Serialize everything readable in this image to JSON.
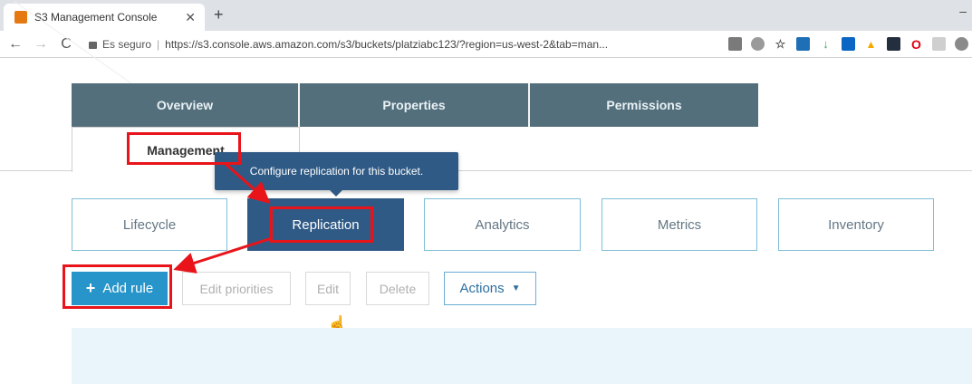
{
  "browser": {
    "tab_title": "S3 Management Console",
    "tab_close": "✕",
    "new_tab": "+",
    "window_minimize": "–",
    "nav": {
      "back": "←",
      "forward": "→",
      "reload": "C"
    },
    "secure_label": "Es seguro",
    "url": "https://s3.console.aws.amazon.com/s3/buckets/platziabc123/?region=us-west-2&tab=man..."
  },
  "top_tabs": [
    {
      "label": "Overview"
    },
    {
      "label": "Properties"
    },
    {
      "label": "Permissions"
    }
  ],
  "active_tab": {
    "label": "Management"
  },
  "tooltip": {
    "text": "Configure replication for this bucket."
  },
  "subtabs": [
    {
      "label": "Lifecycle"
    },
    {
      "label": "Replication"
    },
    {
      "label": "Analytics"
    },
    {
      "label": "Metrics"
    },
    {
      "label": "Inventory"
    }
  ],
  "toolbar": {
    "add_rule": "Add rule",
    "edit_priorities": "Edit priorities",
    "edit": "Edit",
    "delete": "Delete",
    "actions": "Actions"
  },
  "colors": {
    "accent_blue": "#2795c9",
    "tab_bg": "#546f7c",
    "active_subtab": "#2f5a85",
    "annotation_red": "#e8141a"
  }
}
